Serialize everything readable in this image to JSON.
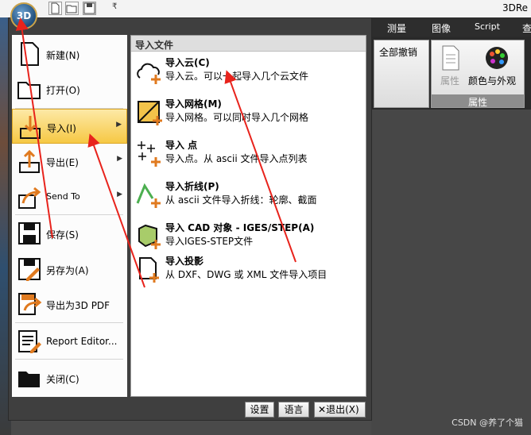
{
  "window": {
    "title": "3DRe",
    "app_button_label": "3D"
  },
  "quick_access": {
    "dropdown": "₹"
  },
  "ribbon": {
    "tabs": [
      "测量",
      "图像",
      "Script",
      "查"
    ],
    "undo_all_label": "全部撤销",
    "properties_label": "属性",
    "appearance_label": "颜色与外观",
    "group_label": "属性"
  },
  "app_menu": {
    "items": [
      {
        "label": "新建(N)",
        "icon": "new-document-icon"
      },
      {
        "label": "打开(O)",
        "icon": "open-folder-icon"
      },
      {
        "label": "导入(I)",
        "icon": "import-icon",
        "submenu": true
      },
      {
        "label": "导出(E)",
        "icon": "export-icon",
        "submenu": true
      },
      {
        "label": "Send To",
        "icon": "send-to-icon",
        "submenu": true
      },
      {
        "label": "保存(S)",
        "icon": "save-icon"
      },
      {
        "label": "另存为(A)",
        "icon": "save-as-icon"
      },
      {
        "label": "导出为3D PDF",
        "icon": "export-3d-pdf-icon"
      },
      {
        "label": "Report Editor...",
        "icon": "report-editor-icon"
      },
      {
        "label": "关闭(C)",
        "icon": "close-folder-icon"
      }
    ],
    "submenu": {
      "header": "导入文件",
      "items": [
        {
          "title": "导入云(C)",
          "desc": "导入云。可以一起导入几个云文件",
          "icon": "cloud-import-icon"
        },
        {
          "title": "导入网格(M)",
          "desc": "导入网格。可以同时导入几个网格",
          "icon": "mesh-import-icon"
        },
        {
          "title": "导入 点",
          "desc": "导入点。从 ascii 文件导入点列表",
          "icon": "points-import-icon"
        },
        {
          "title": "导入折线(P)",
          "desc": "从 ascii 文件导入折线：轮廓、截面",
          "icon": "polyline-import-icon"
        },
        {
          "title": "导入 CAD 对象 - IGES/STEP(A)",
          "desc": "导入IGES-STEP文件",
          "icon": "cad-import-icon"
        },
        {
          "title": "导入投影",
          "desc": "从 DXF、DWG 或 XML 文件导入项目",
          "icon": "projection-import-icon"
        }
      ]
    },
    "buttons": {
      "settings": "设置",
      "language": "语言",
      "exit": "退出(X)"
    }
  },
  "watermark": "CSDN @养了个猫",
  "colors": {
    "highlight": "#f6c844",
    "accent_orange": "#e07a1f",
    "annotation_arrow": "#e8231c"
  }
}
